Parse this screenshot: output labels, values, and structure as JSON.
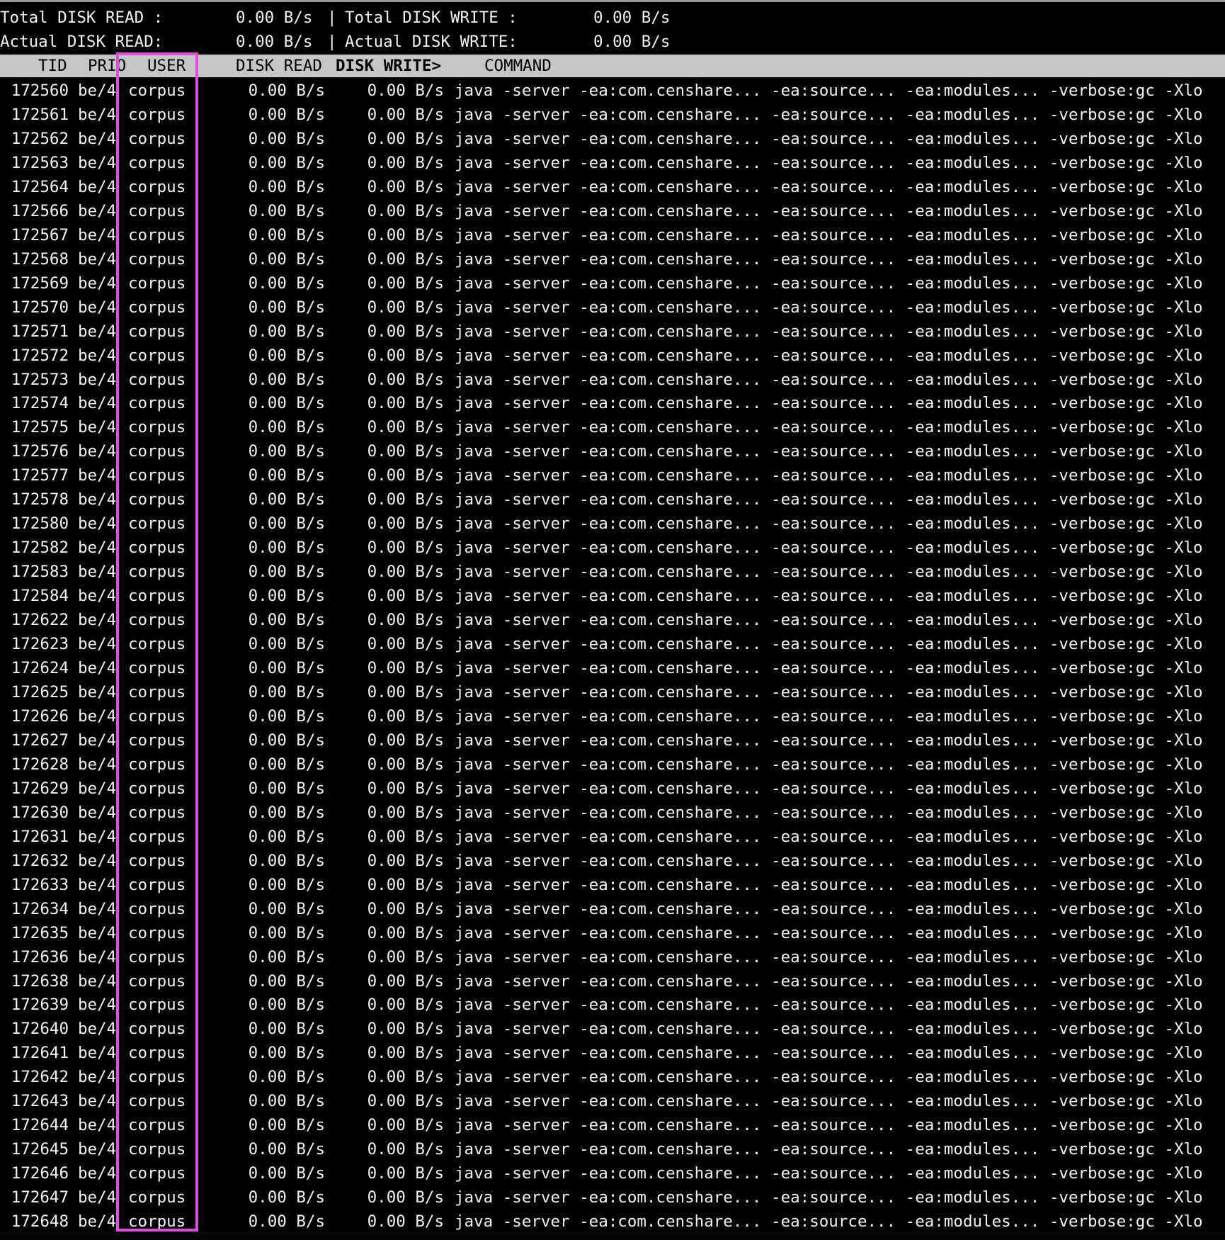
{
  "summary": {
    "total_read_label": "Total DISK READ :",
    "total_read_value": "0.00 B/s",
    "total_write_label": "Total DISK WRITE :",
    "total_write_value": "0.00 B/s",
    "actual_read_label": "Actual DISK READ:",
    "actual_read_value": "0.00 B/s",
    "actual_write_label": "Actual DISK WRITE:",
    "actual_write_value": "0.00 B/s",
    "separator": "|"
  },
  "columns": {
    "tid": "TID",
    "prio": "PRIO",
    "user": "USER",
    "disk_read": "DISK READ",
    "disk_write": "DISK WRITE>",
    "command": "COMMAND"
  },
  "rows": [
    {
      "tid": "172560",
      "prio": "be/4",
      "user": "corpus",
      "read": "0.00 B/s",
      "write": "0.00 B/s",
      "command": "java -server -ea:com.censhare... -ea:source... -ea:modules... -verbose:gc -Xlo"
    },
    {
      "tid": "172561",
      "prio": "be/4",
      "user": "corpus",
      "read": "0.00 B/s",
      "write": "0.00 B/s",
      "command": "java -server -ea:com.censhare... -ea:source... -ea:modules... -verbose:gc -Xlo"
    },
    {
      "tid": "172562",
      "prio": "be/4",
      "user": "corpus",
      "read": "0.00 B/s",
      "write": "0.00 B/s",
      "command": "java -server -ea:com.censhare... -ea:source... -ea:modules... -verbose:gc -Xlo"
    },
    {
      "tid": "172563",
      "prio": "be/4",
      "user": "corpus",
      "read": "0.00 B/s",
      "write": "0.00 B/s",
      "command": "java -server -ea:com.censhare... -ea:source... -ea:modules... -verbose:gc -Xlo"
    },
    {
      "tid": "172564",
      "prio": "be/4",
      "user": "corpus",
      "read": "0.00 B/s",
      "write": "0.00 B/s",
      "command": "java -server -ea:com.censhare... -ea:source... -ea:modules... -verbose:gc -Xlo"
    },
    {
      "tid": "172566",
      "prio": "be/4",
      "user": "corpus",
      "read": "0.00 B/s",
      "write": "0.00 B/s",
      "command": "java -server -ea:com.censhare... -ea:source... -ea:modules... -verbose:gc -Xlo"
    },
    {
      "tid": "172567",
      "prio": "be/4",
      "user": "corpus",
      "read": "0.00 B/s",
      "write": "0.00 B/s",
      "command": "java -server -ea:com.censhare... -ea:source... -ea:modules... -verbose:gc -Xlo"
    },
    {
      "tid": "172568",
      "prio": "be/4",
      "user": "corpus",
      "read": "0.00 B/s",
      "write": "0.00 B/s",
      "command": "java -server -ea:com.censhare... -ea:source... -ea:modules... -verbose:gc -Xlo"
    },
    {
      "tid": "172569",
      "prio": "be/4",
      "user": "corpus",
      "read": "0.00 B/s",
      "write": "0.00 B/s",
      "command": "java -server -ea:com.censhare... -ea:source... -ea:modules... -verbose:gc -Xlo"
    },
    {
      "tid": "172570",
      "prio": "be/4",
      "user": "corpus",
      "read": "0.00 B/s",
      "write": "0.00 B/s",
      "command": "java -server -ea:com.censhare... -ea:source... -ea:modules... -verbose:gc -Xlo"
    },
    {
      "tid": "172571",
      "prio": "be/4",
      "user": "corpus",
      "read": "0.00 B/s",
      "write": "0.00 B/s",
      "command": "java -server -ea:com.censhare... -ea:source... -ea:modules... -verbose:gc -Xlo"
    },
    {
      "tid": "172572",
      "prio": "be/4",
      "user": "corpus",
      "read": "0.00 B/s",
      "write": "0.00 B/s",
      "command": "java -server -ea:com.censhare... -ea:source... -ea:modules... -verbose:gc -Xlo"
    },
    {
      "tid": "172573",
      "prio": "be/4",
      "user": "corpus",
      "read": "0.00 B/s",
      "write": "0.00 B/s",
      "command": "java -server -ea:com.censhare... -ea:source... -ea:modules... -verbose:gc -Xlo"
    },
    {
      "tid": "172574",
      "prio": "be/4",
      "user": "corpus",
      "read": "0.00 B/s",
      "write": "0.00 B/s",
      "command": "java -server -ea:com.censhare... -ea:source... -ea:modules... -verbose:gc -Xlo"
    },
    {
      "tid": "172575",
      "prio": "be/4",
      "user": "corpus",
      "read": "0.00 B/s",
      "write": "0.00 B/s",
      "command": "java -server -ea:com.censhare... -ea:source... -ea:modules... -verbose:gc -Xlo"
    },
    {
      "tid": "172576",
      "prio": "be/4",
      "user": "corpus",
      "read": "0.00 B/s",
      "write": "0.00 B/s",
      "command": "java -server -ea:com.censhare... -ea:source... -ea:modules... -verbose:gc -Xlo"
    },
    {
      "tid": "172577",
      "prio": "be/4",
      "user": "corpus",
      "read": "0.00 B/s",
      "write": "0.00 B/s",
      "command": "java -server -ea:com.censhare... -ea:source... -ea:modules... -verbose:gc -Xlo"
    },
    {
      "tid": "172578",
      "prio": "be/4",
      "user": "corpus",
      "read": "0.00 B/s",
      "write": "0.00 B/s",
      "command": "java -server -ea:com.censhare... -ea:source... -ea:modules... -verbose:gc -Xlo"
    },
    {
      "tid": "172580",
      "prio": "be/4",
      "user": "corpus",
      "read": "0.00 B/s",
      "write": "0.00 B/s",
      "command": "java -server -ea:com.censhare... -ea:source... -ea:modules... -verbose:gc -Xlo"
    },
    {
      "tid": "172582",
      "prio": "be/4",
      "user": "corpus",
      "read": "0.00 B/s",
      "write": "0.00 B/s",
      "command": "java -server -ea:com.censhare... -ea:source... -ea:modules... -verbose:gc -Xlo"
    },
    {
      "tid": "172583",
      "prio": "be/4",
      "user": "corpus",
      "read": "0.00 B/s",
      "write": "0.00 B/s",
      "command": "java -server -ea:com.censhare... -ea:source... -ea:modules... -verbose:gc -Xlo"
    },
    {
      "tid": "172584",
      "prio": "be/4",
      "user": "corpus",
      "read": "0.00 B/s",
      "write": "0.00 B/s",
      "command": "java -server -ea:com.censhare... -ea:source... -ea:modules... -verbose:gc -Xlo"
    },
    {
      "tid": "172622",
      "prio": "be/4",
      "user": "corpus",
      "read": "0.00 B/s",
      "write": "0.00 B/s",
      "command": "java -server -ea:com.censhare... -ea:source... -ea:modules... -verbose:gc -Xlo"
    },
    {
      "tid": "172623",
      "prio": "be/4",
      "user": "corpus",
      "read": "0.00 B/s",
      "write": "0.00 B/s",
      "command": "java -server -ea:com.censhare... -ea:source... -ea:modules... -verbose:gc -Xlo"
    },
    {
      "tid": "172624",
      "prio": "be/4",
      "user": "corpus",
      "read": "0.00 B/s",
      "write": "0.00 B/s",
      "command": "java -server -ea:com.censhare... -ea:source... -ea:modules... -verbose:gc -Xlo"
    },
    {
      "tid": "172625",
      "prio": "be/4",
      "user": "corpus",
      "read": "0.00 B/s",
      "write": "0.00 B/s",
      "command": "java -server -ea:com.censhare... -ea:source... -ea:modules... -verbose:gc -Xlo"
    },
    {
      "tid": "172626",
      "prio": "be/4",
      "user": "corpus",
      "read": "0.00 B/s",
      "write": "0.00 B/s",
      "command": "java -server -ea:com.censhare... -ea:source... -ea:modules... -verbose:gc -Xlo"
    },
    {
      "tid": "172627",
      "prio": "be/4",
      "user": "corpus",
      "read": "0.00 B/s",
      "write": "0.00 B/s",
      "command": "java -server -ea:com.censhare... -ea:source... -ea:modules... -verbose:gc -Xlo"
    },
    {
      "tid": "172628",
      "prio": "be/4",
      "user": "corpus",
      "read": "0.00 B/s",
      "write": "0.00 B/s",
      "command": "java -server -ea:com.censhare... -ea:source... -ea:modules... -verbose:gc -Xlo"
    },
    {
      "tid": "172629",
      "prio": "be/4",
      "user": "corpus",
      "read": "0.00 B/s",
      "write": "0.00 B/s",
      "command": "java -server -ea:com.censhare... -ea:source... -ea:modules... -verbose:gc -Xlo"
    },
    {
      "tid": "172630",
      "prio": "be/4",
      "user": "corpus",
      "read": "0.00 B/s",
      "write": "0.00 B/s",
      "command": "java -server -ea:com.censhare... -ea:source... -ea:modules... -verbose:gc -Xlo"
    },
    {
      "tid": "172631",
      "prio": "be/4",
      "user": "corpus",
      "read": "0.00 B/s",
      "write": "0.00 B/s",
      "command": "java -server -ea:com.censhare... -ea:source... -ea:modules... -verbose:gc -Xlo"
    },
    {
      "tid": "172632",
      "prio": "be/4",
      "user": "corpus",
      "read": "0.00 B/s",
      "write": "0.00 B/s",
      "command": "java -server -ea:com.censhare... -ea:source... -ea:modules... -verbose:gc -Xlo"
    },
    {
      "tid": "172633",
      "prio": "be/4",
      "user": "corpus",
      "read": "0.00 B/s",
      "write": "0.00 B/s",
      "command": "java -server -ea:com.censhare... -ea:source... -ea:modules... -verbose:gc -Xlo"
    },
    {
      "tid": "172634",
      "prio": "be/4",
      "user": "corpus",
      "read": "0.00 B/s",
      "write": "0.00 B/s",
      "command": "java -server -ea:com.censhare... -ea:source... -ea:modules... -verbose:gc -Xlo"
    },
    {
      "tid": "172635",
      "prio": "be/4",
      "user": "corpus",
      "read": "0.00 B/s",
      "write": "0.00 B/s",
      "command": "java -server -ea:com.censhare... -ea:source... -ea:modules... -verbose:gc -Xlo"
    },
    {
      "tid": "172636",
      "prio": "be/4",
      "user": "corpus",
      "read": "0.00 B/s",
      "write": "0.00 B/s",
      "command": "java -server -ea:com.censhare... -ea:source... -ea:modules... -verbose:gc -Xlo"
    },
    {
      "tid": "172638",
      "prio": "be/4",
      "user": "corpus",
      "read": "0.00 B/s",
      "write": "0.00 B/s",
      "command": "java -server -ea:com.censhare... -ea:source... -ea:modules... -verbose:gc -Xlo"
    },
    {
      "tid": "172639",
      "prio": "be/4",
      "user": "corpus",
      "read": "0.00 B/s",
      "write": "0.00 B/s",
      "command": "java -server -ea:com.censhare... -ea:source... -ea:modules... -verbose:gc -Xlo"
    },
    {
      "tid": "172640",
      "prio": "be/4",
      "user": "corpus",
      "read": "0.00 B/s",
      "write": "0.00 B/s",
      "command": "java -server -ea:com.censhare... -ea:source... -ea:modules... -verbose:gc -Xlo"
    },
    {
      "tid": "172641",
      "prio": "be/4",
      "user": "corpus",
      "read": "0.00 B/s",
      "write": "0.00 B/s",
      "command": "java -server -ea:com.censhare... -ea:source... -ea:modules... -verbose:gc -Xlo"
    },
    {
      "tid": "172642",
      "prio": "be/4",
      "user": "corpus",
      "read": "0.00 B/s",
      "write": "0.00 B/s",
      "command": "java -server -ea:com.censhare... -ea:source... -ea:modules... -verbose:gc -Xlo"
    },
    {
      "tid": "172643",
      "prio": "be/4",
      "user": "corpus",
      "read": "0.00 B/s",
      "write": "0.00 B/s",
      "command": "java -server -ea:com.censhare... -ea:source... -ea:modules... -verbose:gc -Xlo"
    },
    {
      "tid": "172644",
      "prio": "be/4",
      "user": "corpus",
      "read": "0.00 B/s",
      "write": "0.00 B/s",
      "command": "java -server -ea:com.censhare... -ea:source... -ea:modules... -verbose:gc -Xlo"
    },
    {
      "tid": "172645",
      "prio": "be/4",
      "user": "corpus",
      "read": "0.00 B/s",
      "write": "0.00 B/s",
      "command": "java -server -ea:com.censhare... -ea:source... -ea:modules... -verbose:gc -Xlo"
    },
    {
      "tid": "172646",
      "prio": "be/4",
      "user": "corpus",
      "read": "0.00 B/s",
      "write": "0.00 B/s",
      "command": "java -server -ea:com.censhare... -ea:source... -ea:modules... -verbose:gc -Xlo"
    },
    {
      "tid": "172647",
      "prio": "be/4",
      "user": "corpus",
      "read": "0.00 B/s",
      "write": "0.00 B/s",
      "command": "java -server -ea:com.censhare... -ea:source... -ea:modules... -verbose:gc -Xlo"
    },
    {
      "tid": "172648",
      "prio": "be/4",
      "user": "corpus",
      "read": "0.00 B/s",
      "write": "0.00 B/s",
      "command": "java -server -ea:com.censhare... -ea:source... -ea:modules... -verbose:gc -Xlo"
    }
  ],
  "colors": {
    "background": "#000000",
    "text": "#f2f2f2",
    "header_bg": "#c6c6c6",
    "header_text": "#000000",
    "highlight_border": "#e04ee0"
  }
}
